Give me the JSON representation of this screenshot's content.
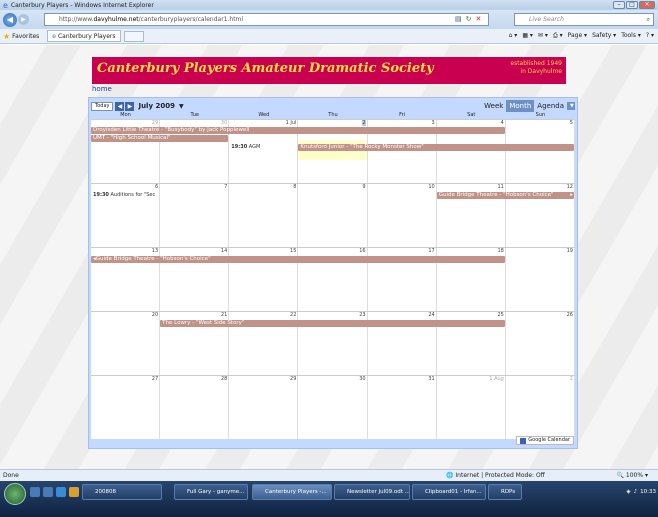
{
  "window": {
    "title": "Canterbury Players - Windows Internet Explorer"
  },
  "address": {
    "url_prefix": "http://www.",
    "url_domain": "davyhulme.net",
    "url_path": "/canterburyplayers/calendar1.html",
    "search_placeholder": "Live Search"
  },
  "favorites": {
    "label": "Favorites",
    "tab_label": "Canterbury Players"
  },
  "commands": {
    "page": "Page ▾",
    "safety": "Safety ▾",
    "tools": "Tools ▾"
  },
  "site": {
    "title": "Canterbury Players Amateur Dramatic Society",
    "est_line1": "established 1949",
    "est_line2": "in Davyhulme",
    "home_link": "home"
  },
  "calendar": {
    "today_button": "Today",
    "month_label": "July 2009",
    "views": [
      "Week",
      "Month",
      "Agenda"
    ],
    "weekdays": [
      "Mon",
      "Tue",
      "Wed",
      "Thu",
      "Fri",
      "Sat",
      "Sun"
    ],
    "weeks": [
      {
        "days": [
          "29",
          "30",
          "1 Jul",
          "2",
          "3",
          "4",
          "5"
        ],
        "gray": [
          0,
          1
        ],
        "highlight": 3
      },
      {
        "days": [
          "6",
          "7",
          "8",
          "9",
          "10",
          "11",
          "12"
        ],
        "gray": []
      },
      {
        "days": [
          "13",
          "14",
          "15",
          "16",
          "17",
          "18",
          "19"
        ],
        "gray": []
      },
      {
        "days": [
          "20",
          "21",
          "22",
          "23",
          "24",
          "25",
          "26"
        ],
        "gray": []
      },
      {
        "days": [
          "27",
          "28",
          "29",
          "30",
          "31",
          "1 Aug",
          "2"
        ],
        "gray": [
          5,
          6
        ]
      }
    ],
    "events": {
      "e1": "Droylsden Little Theatre - \"Busybody\" by Jack Popplewell",
      "e2": "UMT - \"High School Musical\"",
      "e3_time": "19:30",
      "e3_title": "AGM",
      "e4": "Knutsford Junior - \"The Rocky Monster Show\"",
      "e5_time": "19:30",
      "e5_title": "Auditions for \"Sec",
      "e6": "Guide Bridge Theatre - \"Hobson's Choice\"",
      "e7": "Guide Bridge Theatre - \"Hobson's Choice\"",
      "e8": "The Lowry - \"West Side Story\""
    },
    "google_badge": "Google Calendar"
  },
  "status": {
    "left": "Done",
    "zone": "Internet | Protected Mode: Off",
    "zoom": "100%"
  },
  "taskbar": {
    "buttons": [
      "200808",
      "Full Gary - ganyme...",
      "Canterbury Players -...",
      "Newsletter Jul09.odt ...",
      "Clipboard01 - Irfan...",
      "RDPs"
    ],
    "clock": "10:33"
  }
}
